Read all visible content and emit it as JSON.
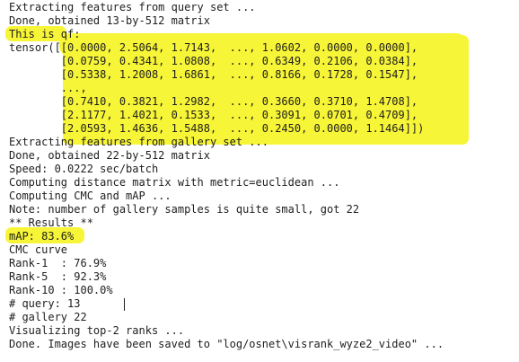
{
  "highlight_color": "#f7f537",
  "terminal": {
    "lines": [
      "Extracting features from query set ...",
      "Done, obtained 13-by-512 matrix",
      "This is qf:",
      "tensor([[0.0000, 2.5064, 1.7143,  ..., 1.0602, 0.0000, 0.0000],",
      "        [0.0759, 0.4341, 1.0808,  ..., 0.6349, 0.2106, 0.0384],",
      "        [0.5338, 1.2008, 1.6861,  ..., 0.8166, 0.1728, 0.1547],",
      "        ...,",
      "        [0.7410, 0.3821, 1.2982,  ..., 0.3660, 0.3710, 1.4708],",
      "        [2.1177, 1.4021, 0.1533,  ..., 0.3091, 0.0701, 0.4709],",
      "        [2.0593, 1.4636, 1.5488,  ..., 0.2450, 0.0000, 1.1464]])",
      "Extracting features from gallery set ...",
      "Done, obtained 22-by-512 matrix",
      "Speed: 0.0222 sec/batch",
      "Computing distance matrix with metric=euclidean ...",
      "Computing CMC and mAP ...",
      "Note: number of gallery samples is quite small, got 22",
      "** Results **",
      "mAP: 83.6%",
      "CMC curve",
      "Rank-1  : 76.9%",
      "Rank-5  : 92.3%",
      "Rank-10 : 100.0%",
      "# query: 13",
      "# gallery 22",
      "Visualizing top-2 ranks ...",
      "Done. Images have been saved to \"log/osnet\\visrank_wyze2_video\" ..."
    ]
  }
}
